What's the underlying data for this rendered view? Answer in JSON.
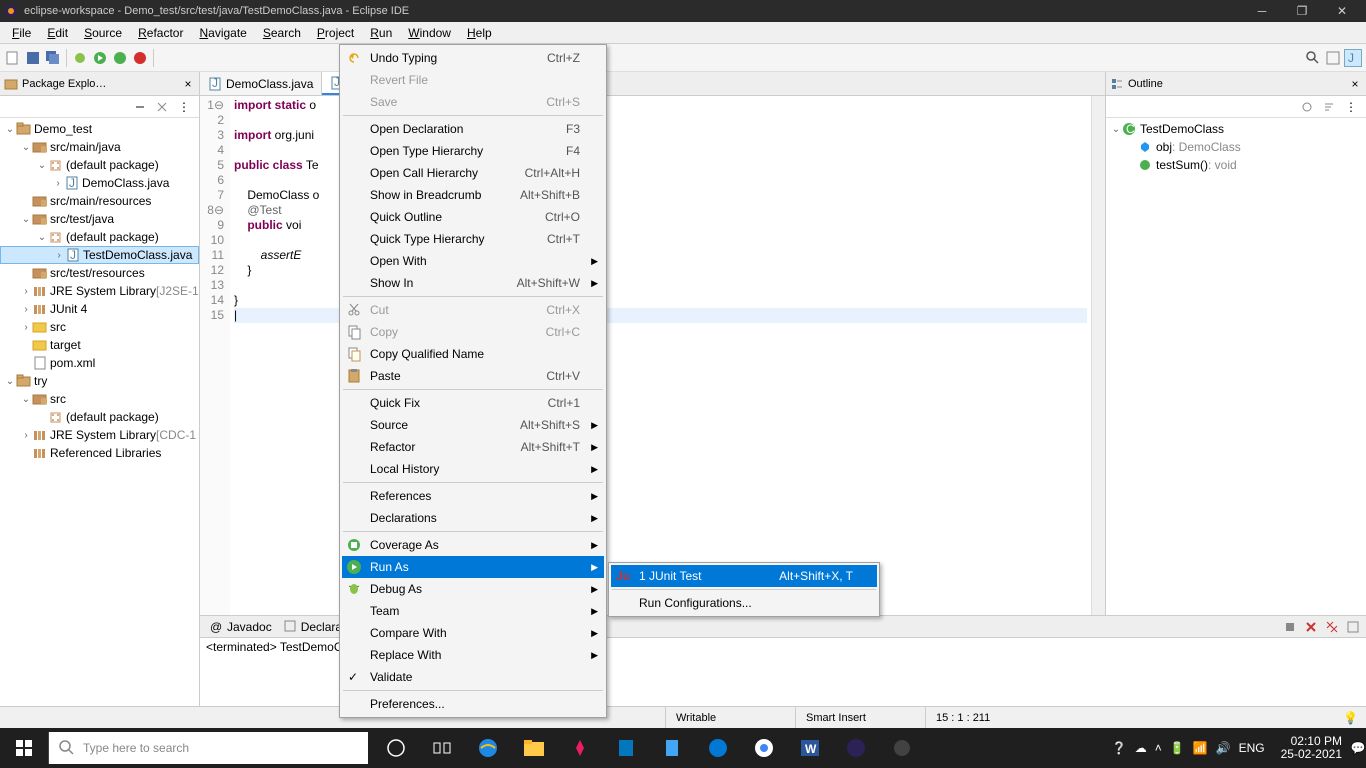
{
  "title_bar": {
    "title": "eclipse-workspace - Demo_test/src/test/java/TestDemoClass.java - Eclipse IDE"
  },
  "menu_bar": {
    "items": [
      "File",
      "Edit",
      "Source",
      "Refactor",
      "Navigate",
      "Search",
      "Project",
      "Run",
      "Window",
      "Help"
    ]
  },
  "package_explorer": {
    "title": "Package Explo…",
    "tree": [
      {
        "indent": 0,
        "twist": "v",
        "icon": "project",
        "label": "Demo_test"
      },
      {
        "indent": 1,
        "twist": "v",
        "icon": "srcfolder",
        "label": "src/main/java"
      },
      {
        "indent": 2,
        "twist": "v",
        "icon": "package",
        "label": "(default package)"
      },
      {
        "indent": 3,
        "twist": ">",
        "icon": "java",
        "label": "DemoClass.java"
      },
      {
        "indent": 1,
        "twist": "",
        "icon": "srcfolder",
        "label": "src/main/resources"
      },
      {
        "indent": 1,
        "twist": "v",
        "icon": "srcfolder",
        "label": "src/test/java"
      },
      {
        "indent": 2,
        "twist": "v",
        "icon": "package",
        "label": "(default package)"
      },
      {
        "indent": 3,
        "twist": ">",
        "icon": "java",
        "label": "TestDemoClass.java",
        "selected": true
      },
      {
        "indent": 1,
        "twist": "",
        "icon": "srcfolder",
        "label": "src/test/resources"
      },
      {
        "indent": 1,
        "twist": ">",
        "icon": "library",
        "label": "JRE System Library",
        "suffix": "[J2SE-1"
      },
      {
        "indent": 1,
        "twist": ">",
        "icon": "library",
        "label": "JUnit 4"
      },
      {
        "indent": 1,
        "twist": ">",
        "icon": "folder",
        "label": "src"
      },
      {
        "indent": 1,
        "twist": "",
        "icon": "folder",
        "label": "target"
      },
      {
        "indent": 1,
        "twist": "",
        "icon": "file",
        "label": "pom.xml"
      },
      {
        "indent": 0,
        "twist": "v",
        "icon": "project",
        "label": "try"
      },
      {
        "indent": 1,
        "twist": "v",
        "icon": "srcfolder",
        "label": "src"
      },
      {
        "indent": 2,
        "twist": "",
        "icon": "package",
        "label": "(default package)"
      },
      {
        "indent": 1,
        "twist": ">",
        "icon": "library",
        "label": "JRE System Library",
        "suffix": "[CDC-1"
      },
      {
        "indent": 1,
        "twist": "",
        "icon": "library",
        "label": "Referenced Libraries"
      }
    ]
  },
  "editor": {
    "tabs": [
      {
        "label": "DemoClass.java",
        "active": false
      },
      {
        "label": "T",
        "active": true
      }
    ],
    "lines": [
      "1",
      "2",
      "3",
      "4",
      "5",
      "6",
      "7",
      "8",
      "9",
      "10",
      "11",
      "12",
      "13",
      "14",
      "15"
    ],
    "code_html": "<span class='kw'>import static</span> o\n\n<span class='kw'>import</span> org.juni\n\n<span class='kw'>public class</span> Te\n\n    DemoClass o\n    <span class='ann'>@Test</span>\n    <span class='kw'>public</span> voi\n\n        <span class='it'>assertE</span>\n    }\n\n}\n<span class='caret-line'>|</span>"
  },
  "context_menu": {
    "items": [
      {
        "label": "Undo Typing",
        "shortcut": "Ctrl+Z",
        "icon": "undo"
      },
      {
        "label": "Revert File",
        "disabled": true
      },
      {
        "label": "Save",
        "shortcut": "Ctrl+S",
        "disabled": true
      },
      {
        "sep": true
      },
      {
        "label": "Open Declaration",
        "shortcut": "F3"
      },
      {
        "label": "Open Type Hierarchy",
        "shortcut": "F4"
      },
      {
        "label": "Open Call Hierarchy",
        "shortcut": "Ctrl+Alt+H"
      },
      {
        "label": "Show in Breadcrumb",
        "shortcut": "Alt+Shift+B"
      },
      {
        "label": "Quick Outline",
        "shortcut": "Ctrl+O"
      },
      {
        "label": "Quick Type Hierarchy",
        "shortcut": "Ctrl+T"
      },
      {
        "label": "Open With",
        "submenu": true
      },
      {
        "label": "Show In",
        "shortcut": "Alt+Shift+W",
        "submenu": true
      },
      {
        "sep": true
      },
      {
        "label": "Cut",
        "shortcut": "Ctrl+X",
        "icon": "cut",
        "disabled": true
      },
      {
        "label": "Copy",
        "shortcut": "Ctrl+C",
        "icon": "copy",
        "disabled": true
      },
      {
        "label": "Copy Qualified Name",
        "icon": "copyq"
      },
      {
        "label": "Paste",
        "shortcut": "Ctrl+V",
        "icon": "paste"
      },
      {
        "sep": true
      },
      {
        "label": "Quick Fix",
        "shortcut": "Ctrl+1"
      },
      {
        "label": "Source",
        "shortcut": "Alt+Shift+S",
        "submenu": true
      },
      {
        "label": "Refactor",
        "shortcut": "Alt+Shift+T",
        "submenu": true
      },
      {
        "label": "Local History",
        "submenu": true
      },
      {
        "sep": true
      },
      {
        "label": "References",
        "submenu": true
      },
      {
        "label": "Declarations",
        "submenu": true
      },
      {
        "sep": true
      },
      {
        "label": "Coverage As",
        "icon": "coverage",
        "submenu": true
      },
      {
        "label": "Run As",
        "icon": "run",
        "submenu": true,
        "selected": true
      },
      {
        "label": "Debug As",
        "icon": "debug",
        "submenu": true
      },
      {
        "label": "Team",
        "submenu": true
      },
      {
        "label": "Compare With",
        "submenu": true
      },
      {
        "label": "Replace With",
        "submenu": true
      },
      {
        "label": "Validate",
        "checked": true
      },
      {
        "sep": true
      },
      {
        "label": "Preferences..."
      }
    ]
  },
  "sub_menu": {
    "items": [
      {
        "label": "1 JUnit Test",
        "shortcut": "Alt+Shift+X, T",
        "icon": "junit",
        "selected": true
      },
      {
        "sep": true
      },
      {
        "label": "Run Configurations..."
      }
    ]
  },
  "outline": {
    "title": "Outline",
    "tree": [
      {
        "indent": 0,
        "twist": "v",
        "icon": "class",
        "label": "TestDemoClass"
      },
      {
        "indent": 1,
        "twist": "",
        "icon": "field",
        "label": "obj",
        "ret": ": DemoClass"
      },
      {
        "indent": 1,
        "twist": "",
        "icon": "method",
        "label": "testSum()",
        "ret": ": void"
      }
    ]
  },
  "bottom_panel": {
    "tabs": [
      "Javadoc",
      "Declarati"
    ],
    "content": "<terminated> TestDemoCl"
  },
  "status_bar": {
    "writable": "Writable",
    "insert": "Smart Insert",
    "pos": "15 : 1 : 211"
  },
  "taskbar": {
    "search_placeholder": "Type here to search",
    "time": "02:10 PM",
    "date": "25-02-2021",
    "lang": "ENG"
  }
}
